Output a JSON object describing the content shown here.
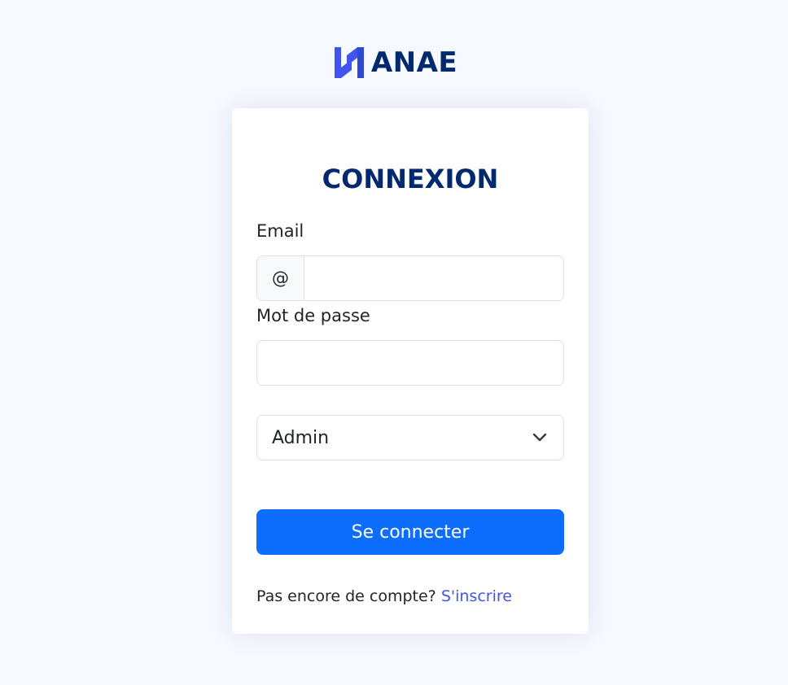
{
  "brand": {
    "name": "ANAE",
    "logo_icon": "anae-logo-icon",
    "color": "#012970",
    "logo_color": "#4154f1"
  },
  "login": {
    "title": "CONNEXION",
    "email_label": "Email",
    "email_prefix": "@",
    "email_value": "",
    "password_label": "Mot de passe",
    "password_value": "",
    "role_selected": "Admin",
    "role_icon": "chevron-down-icon",
    "submit_label": "Se connecter",
    "signup_prompt": "Pas encore de compte?",
    "signup_link": "S'inscrire"
  },
  "colors": {
    "background": "#f6f9ff",
    "primary_button": "#0d6efd",
    "link": "#4154f1",
    "title": "#012970"
  }
}
